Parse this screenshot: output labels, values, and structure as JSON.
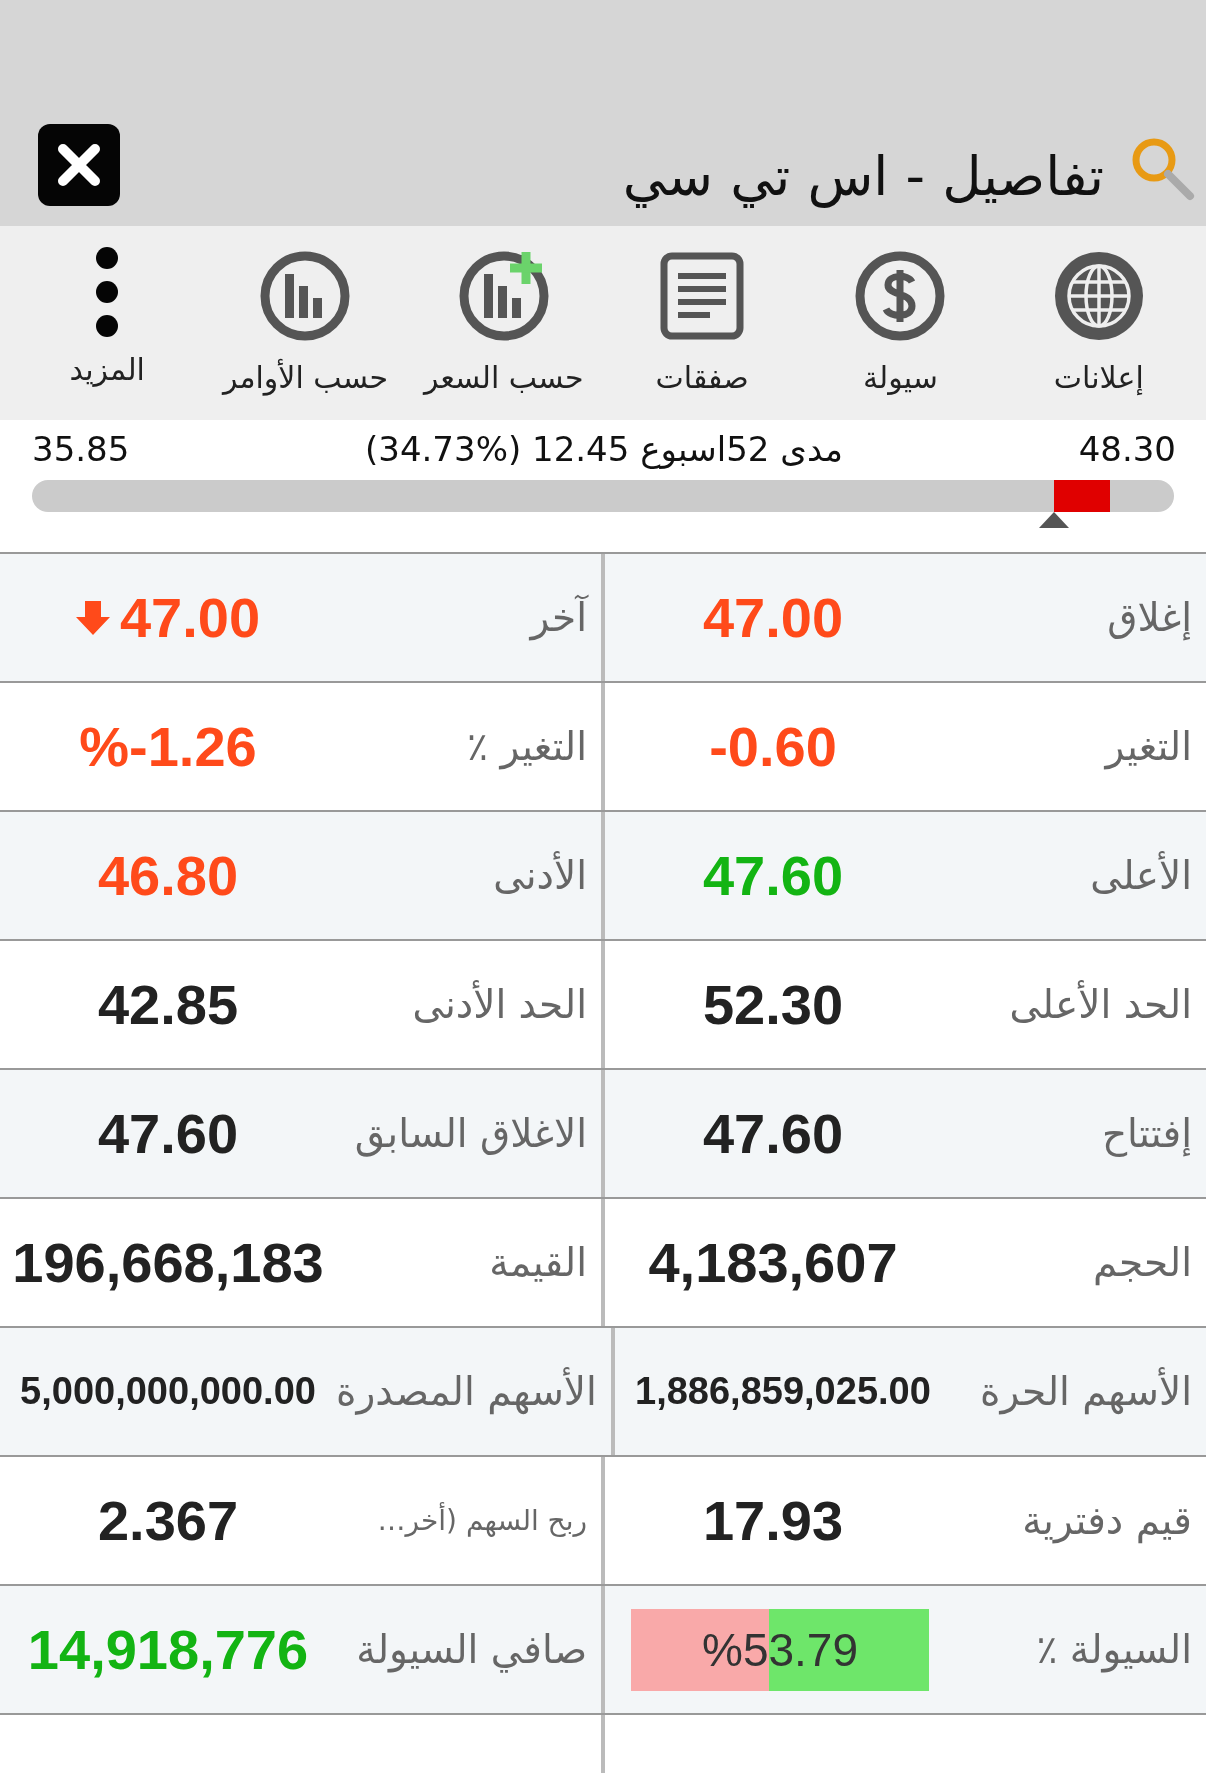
{
  "header": {
    "title": "تفاصيل - اس تي سي"
  },
  "toolbar": [
    {
      "kind": "globe",
      "label": "إعلانات"
    },
    {
      "kind": "dollar",
      "label": "سيولة"
    },
    {
      "kind": "document",
      "label": "صفقات"
    },
    {
      "kind": "chart-plus",
      "label": "حسب السعر"
    },
    {
      "kind": "chart",
      "label": "حسب الأوامر"
    },
    {
      "kind": "more",
      "label": "المزيد"
    }
  ],
  "range": {
    "high": "48.30",
    "caption": "مدى 52اسبوع 12.45 (%34.73)",
    "low": "35.85",
    "level": 0.895
  },
  "rows": [
    [
      {
        "kind": "plain",
        "label": "إغلاق",
        "value": "47.00",
        "color": "#ff4a1a"
      },
      {
        "kind": "arrow-down",
        "label": "آخر",
        "value": "47.00",
        "color": "#ff4a1a"
      }
    ],
    [
      {
        "kind": "plain",
        "label": "التغير",
        "value": "-0.60",
        "color": "#ff4a1a"
      },
      {
        "kind": "plain",
        "label": "التغير ٪",
        "value": "%-1.26",
        "color": "#ff4a1a"
      }
    ],
    [
      {
        "kind": "plain",
        "label": "الأعلى",
        "value": "47.60",
        "color": "#13b413"
      },
      {
        "kind": "plain",
        "label": "الأدنى",
        "value": "46.80",
        "color": "#ff4a1a"
      }
    ],
    [
      {
        "kind": "plain",
        "label": "الحد الأعلى",
        "value": "52.30",
        "color": "#222222"
      },
      {
        "kind": "plain",
        "label": "الحد الأدنى",
        "value": "42.85",
        "color": "#222222"
      }
    ],
    [
      {
        "kind": "plain",
        "label": "إفتتاح",
        "value": "47.60",
        "color": "#222222"
      },
      {
        "kind": "plain",
        "label": "الاغلاق السابق",
        "value": "47.60",
        "color": "#222222"
      }
    ],
    [
      {
        "kind": "plain",
        "label": "الحجم",
        "value": "4,183,607",
        "color": "#222222"
      },
      {
        "kind": "plain",
        "label": "القيمة",
        "value": "196,668,183",
        "color": "#222222"
      }
    ],
    [
      {
        "kind": "long",
        "label": "الأسهم الحرة",
        "value": "1,886,859,025.00",
        "color": "#222222"
      },
      {
        "kind": "long",
        "label": "الأسهم المصدرة",
        "value": "5,000,000,000.00",
        "color": "#222222"
      }
    ],
    [
      {
        "kind": "plain",
        "label": "قيم دفترية",
        "value": "17.93",
        "color": "#222222"
      },
      {
        "kind": "small-label",
        "label": "ربح السهم (أخر…",
        "value": "2.367",
        "color": "#222222"
      }
    ],
    [
      {
        "kind": "bar",
        "label": "السيولة ٪",
        "value": "%53.79",
        "level": 0.5379
      },
      {
        "kind": "plain",
        "label": "صافي السيولة",
        "value": "14,918,776",
        "color": "#13b413"
      }
    ]
  ]
}
